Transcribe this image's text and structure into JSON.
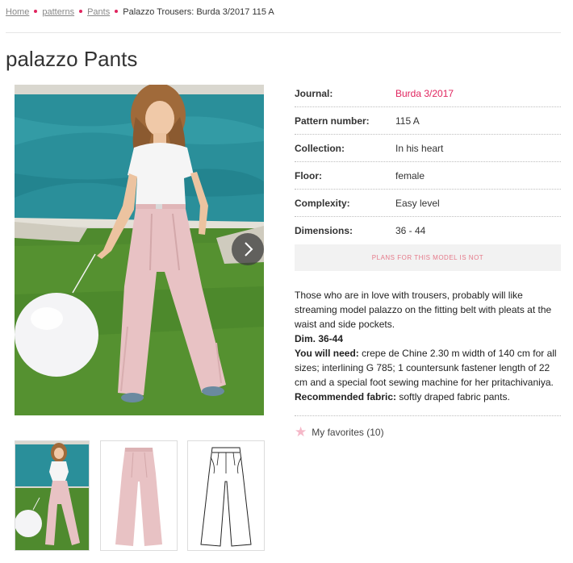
{
  "breadcrumb": {
    "home": "Home",
    "patterns": "patterns",
    "pants": "Pants",
    "current": "Palazzo Trousers: Burda 3/2017 115 A"
  },
  "page": {
    "title": "palazzo Pants"
  },
  "specs": [
    {
      "label": "Journal:",
      "value": "Burda 3/2017"
    },
    {
      "label": "Pattern number:",
      "value": "115 A"
    },
    {
      "label": "Collection:",
      "value": "In his heart"
    },
    {
      "label": "Floor:",
      "value": "female"
    },
    {
      "label": "Complexity:",
      "value": "Easy level"
    },
    {
      "label": "Dimensions:",
      "value": "36 - 44"
    }
  ],
  "plans_notice": "PLANS FOR THIS MODEL IS NOT",
  "description": {
    "intro": "Those who are in love with trousers, probably will like streaming model palazzo on the fitting belt with pleats at the waist and side pockets.",
    "dim": "Dim. 36-44",
    "need_label": "You will need:",
    "need_text": " crepe de Chine 2.30 m width of 140 cm for all sizes; interlining G 785; 1 countersunk fastener length of 22 cm and a special foot sewing machine for her pritachivaniya.",
    "fabric_label": "Recommended fabric:",
    "fabric_text": " softly draped fabric pants."
  },
  "favorites": {
    "label": "My favorites (10)",
    "icon": "star-icon"
  },
  "colors": {
    "accent": "#e0245e",
    "pool": "#2a8f9a",
    "grass": "#4f8a2e",
    "pants": "#e8c2c4"
  },
  "icons": {
    "next": "chevron-right-icon"
  }
}
